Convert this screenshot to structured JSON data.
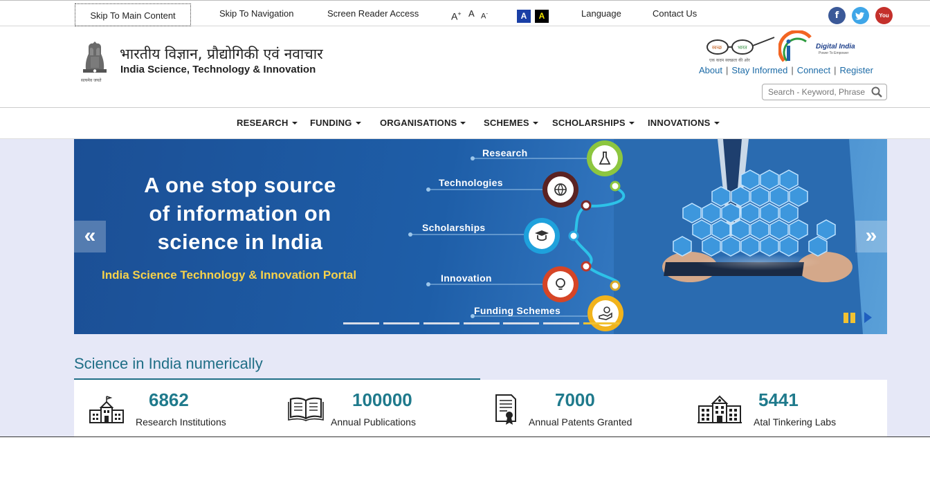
{
  "accessibility_bar": {
    "skip_main": "Skip To Main Content",
    "skip_nav": "Skip To Navigation",
    "screen_reader": "Screen Reader Access",
    "font_increase": "A",
    "font_increase_sup": "+",
    "font_normal": "A",
    "font_decrease": "A",
    "font_decrease_sup": "-",
    "contrast_blue": "A",
    "contrast_black": "A",
    "language": "Language",
    "contact": "Contact Us",
    "social": {
      "facebook": "f",
      "twitter": "t",
      "youtube": "You"
    }
  },
  "header": {
    "site_name_hindi": "भारतीय विज्ञान, प्रौद्योगिकी एवं नवाचार",
    "site_name_english": "India Science, Technology & Innovation",
    "emblem_caption": "सत्यमेव जयते",
    "swachh_text_1": "स्वच्छ",
    "swachh_text_2": "भारत",
    "swachh_caption": "एक कदम स्वच्छता की ओर",
    "digital_india_title": "Digital India",
    "digital_india_caption": "Power To Empower",
    "links": [
      "About",
      "Stay Informed",
      "Connect",
      "Register"
    ],
    "search_placeholder": "Search - Keyword, Phrase"
  },
  "nav": {
    "items": [
      "RESEARCH",
      "FUNDING",
      "ORGANISATIONS",
      "SCHEMES",
      "SCHOLARSHIPS",
      "INNOVATIONS"
    ]
  },
  "banner": {
    "headline_1": "A one stop source",
    "headline_2": "of information on",
    "headline_3": "science in India",
    "tagline": "India Science Technology & Innovation Portal",
    "labels": [
      "Research",
      "Technologies",
      "Scholarships",
      "Innovation",
      "Funding Schemes"
    ],
    "prev": "«",
    "next": "»",
    "slide_count": 7,
    "active_slide": 7
  },
  "stats": {
    "title": "Science in India numerically",
    "items": [
      {
        "value": "6862",
        "label": "Research Institutions",
        "icon": "institution-icon"
      },
      {
        "value": "100000",
        "label": "Annual Publications",
        "icon": "book-icon"
      },
      {
        "value": "7000",
        "label": "Annual Patents Granted",
        "icon": "certificate-icon"
      },
      {
        "value": "5441",
        "label": "Atal Tinkering Labs",
        "icon": "building-icon"
      }
    ]
  },
  "colors": {
    "link_blue": "#1b6aa6",
    "stat_teal": "#1f7a8c",
    "banner_blue": "#1e5ea8",
    "tagline_yellow": "#f7d24a",
    "page_background": "#e6e8f7"
  }
}
